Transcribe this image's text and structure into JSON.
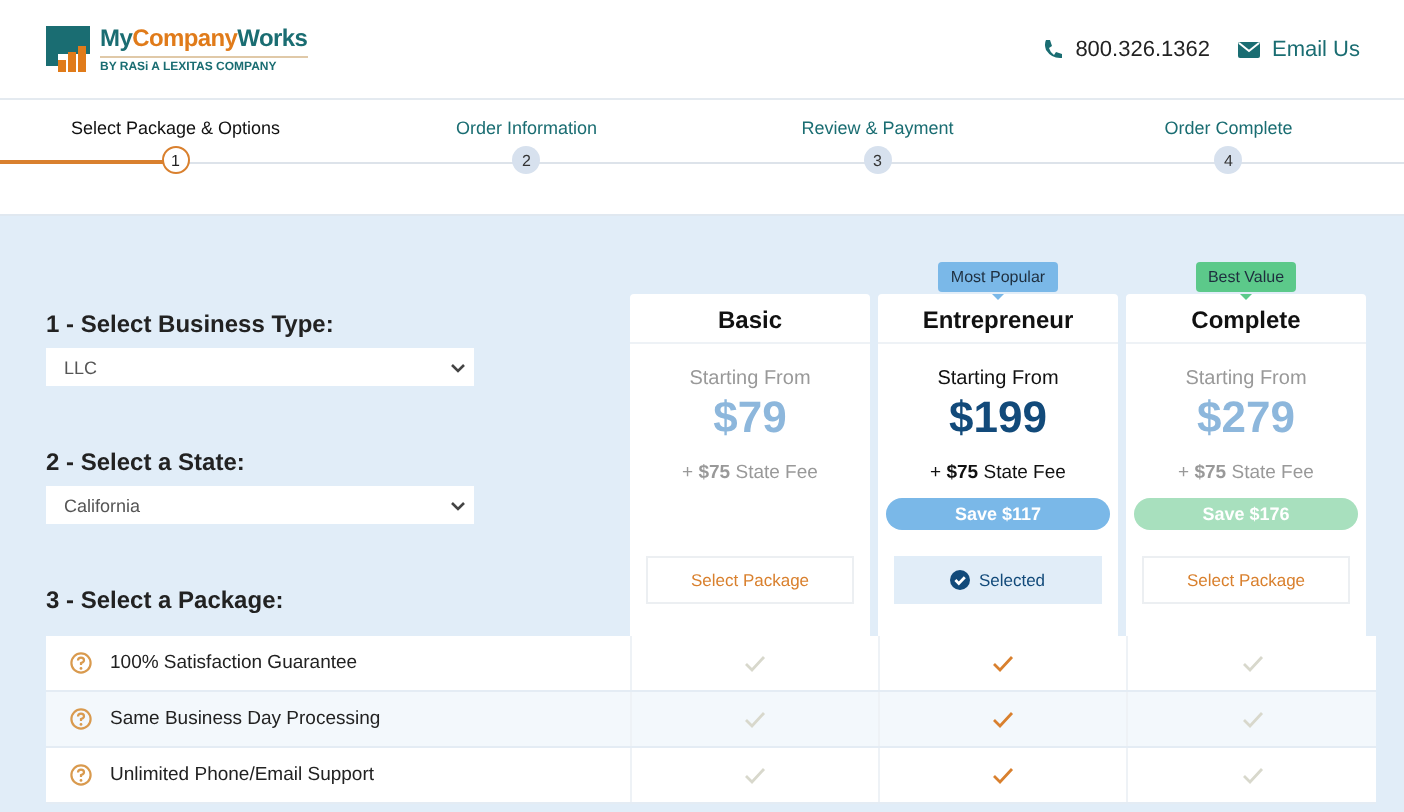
{
  "header": {
    "logo": {
      "name_parts": [
        "My",
        "Company",
        "Works"
      ],
      "tagline": "BY RASi A LEXITAS COMPANY"
    },
    "phone": "800.326.1362",
    "email_link": "Email Us"
  },
  "steps": [
    {
      "label": "Select Package & Options",
      "number": "1",
      "selected": true
    },
    {
      "label": "Order Information",
      "number": "2",
      "selected": false
    },
    {
      "label": "Review & Payment",
      "number": "3",
      "selected": false
    },
    {
      "label": "Order Complete",
      "number": "4",
      "selected": false
    }
  ],
  "form": [
    {
      "label": "1 - Select Business Type:",
      "value": "LLC"
    },
    {
      "label": "2 - Select a State:",
      "value": "California"
    }
  ],
  "package_heading": "3 - Select a Package:",
  "packages": [
    {
      "name": "Basic",
      "starting": "Starting From",
      "price": "$79",
      "fee_prefix": "+ ",
      "fee_amount": "$75",
      "fee_suffix": " State Fee",
      "button": "Select Package",
      "selected": false
    },
    {
      "name": "Entrepreneur",
      "badge": {
        "text": "Most Popular",
        "color": "#7ab8e8"
      },
      "starting": "Starting From",
      "price": "$199",
      "fee_prefix": "+ ",
      "fee_amount": "$75",
      "fee_suffix": " State Fee",
      "save": {
        "text": "Save $117",
        "color": "#7ab8e8"
      },
      "button": "Selected",
      "selected": true
    },
    {
      "name": "Complete",
      "badge": {
        "text": "Best Value",
        "color": "#5cc98a"
      },
      "starting": "Starting From",
      "price": "$279",
      "fee_prefix": "+ ",
      "fee_amount": "$75",
      "fee_suffix": " State Fee",
      "save": {
        "text": "Save $176",
        "color": "#a8e0be"
      },
      "button": "Select Package",
      "selected": false
    }
  ],
  "features": [
    {
      "label": "100% Satisfaction Guarantee",
      "included": [
        true,
        true,
        true
      ]
    },
    {
      "label": "Same Business Day Processing",
      "included": [
        true,
        true,
        true
      ]
    },
    {
      "label": "Unlimited Phone/Email Support",
      "included": [
        true,
        true,
        true
      ]
    }
  ]
}
